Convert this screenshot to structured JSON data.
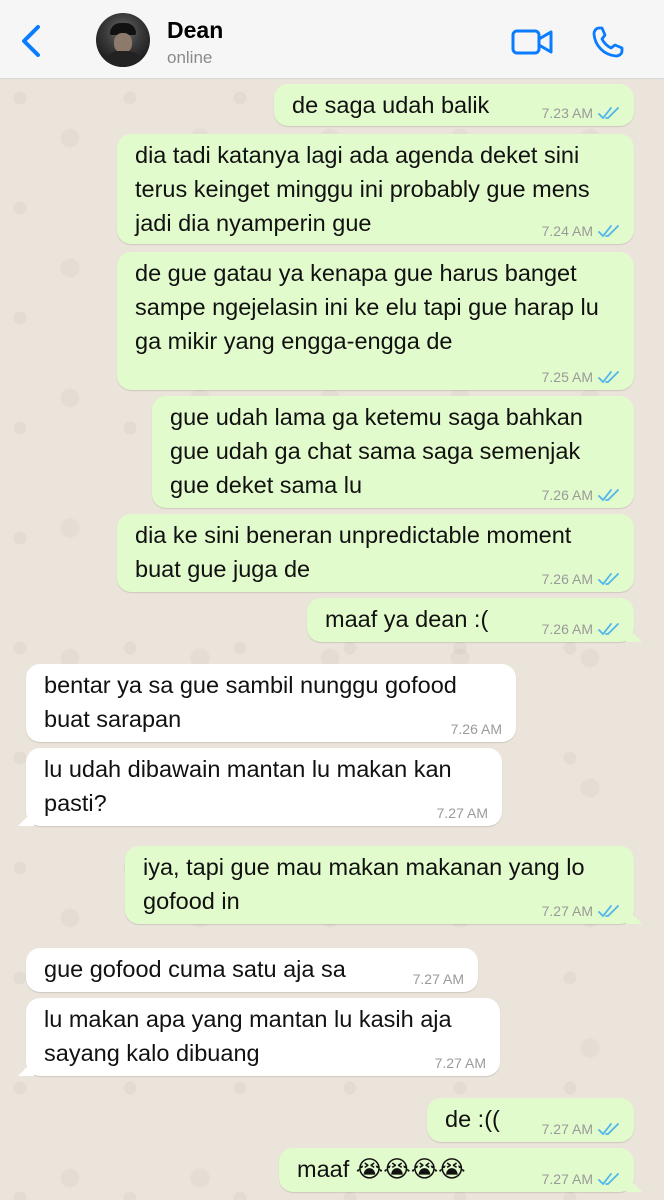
{
  "header": {
    "contact_name": "Dean",
    "status": "online"
  },
  "icons": {
    "back": "chevron-left-icon",
    "video": "video-camera-icon",
    "call": "phone-icon",
    "read": "double-check-icon"
  },
  "colors": {
    "accent": "#0a7cff",
    "outgoing_bubble": "#e2fbcc",
    "incoming_bubble": "#ffffff",
    "read_ticks": "#4fb6ec"
  },
  "messages": [
    {
      "text": "de saga udah balik",
      "time": "7.23 AM",
      "direction": "outgoing",
      "read": true
    },
    {
      "text": "dia tadi katanya lagi ada agenda deket sini terus keinget minggu ini probably gue mens jadi dia nyamperin gue",
      "time": "7.24 AM",
      "direction": "outgoing",
      "read": true
    },
    {
      "text": "de gue gatau ya kenapa gue harus banget sampe ngejelasin ini ke elu tapi gue harap lu ga mikir yang engga-engga de",
      "time": "7.25 AM",
      "direction": "outgoing",
      "read": true
    },
    {
      "text": "gue udah lama ga ketemu saga bahkan gue udah ga chat sama saga semenjak gue deket sama lu",
      "time": "7.26 AM",
      "direction": "outgoing",
      "read": true
    },
    {
      "text": "dia ke sini beneran unpredictable moment buat gue juga de",
      "time": "7.26 AM",
      "direction": "outgoing",
      "read": true
    },
    {
      "text": "maaf ya dean :(",
      "time": "7.26 AM",
      "direction": "outgoing",
      "read": true
    },
    {
      "text": "bentar ya sa gue sambil nunggu gofood buat sarapan",
      "time": "7.26 AM",
      "direction": "incoming",
      "read": false
    },
    {
      "text": "lu udah dibawain mantan lu makan kan pasti?",
      "time": "7.27 AM",
      "direction": "incoming",
      "read": false
    },
    {
      "text": "iya, tapi gue mau makan makanan yang lo gofood in",
      "time": "7.27 AM",
      "direction": "outgoing",
      "read": true
    },
    {
      "text": "gue gofood cuma satu aja sa",
      "time": "7.27 AM",
      "direction": "incoming",
      "read": false
    },
    {
      "text": "lu makan apa yang mantan lu kasih aja sayang kalo dibuang",
      "time": "7.27 AM",
      "direction": "incoming",
      "read": false
    },
    {
      "text": "de :((",
      "time": "7.27 AM",
      "direction": "outgoing",
      "read": true
    },
    {
      "text": "maaf 😭😭😭😭",
      "time": "7.27 AM",
      "direction": "outgoing",
      "read": true
    }
  ]
}
